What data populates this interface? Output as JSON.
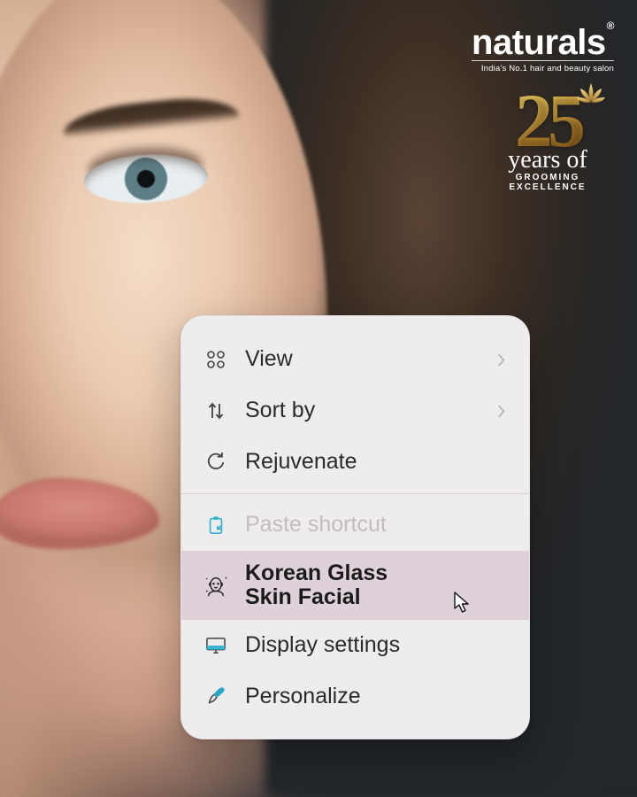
{
  "brand": {
    "name": "naturals",
    "registered": "®",
    "tagline": "India's No.1 hair and beauty salon"
  },
  "anniversary": {
    "number": "25",
    "script": "years of",
    "sub1": "GROOMING",
    "sub2": "EXCELLENCE"
  },
  "menu": {
    "items": [
      {
        "label": "View"
      },
      {
        "label": "Sort by"
      },
      {
        "label": "Rejuvenate"
      },
      {
        "label": "Paste shortcut"
      },
      {
        "label": "Korean Glass\nSkin Facial"
      },
      {
        "label": "Display settings"
      },
      {
        "label": "Personalize"
      }
    ]
  }
}
